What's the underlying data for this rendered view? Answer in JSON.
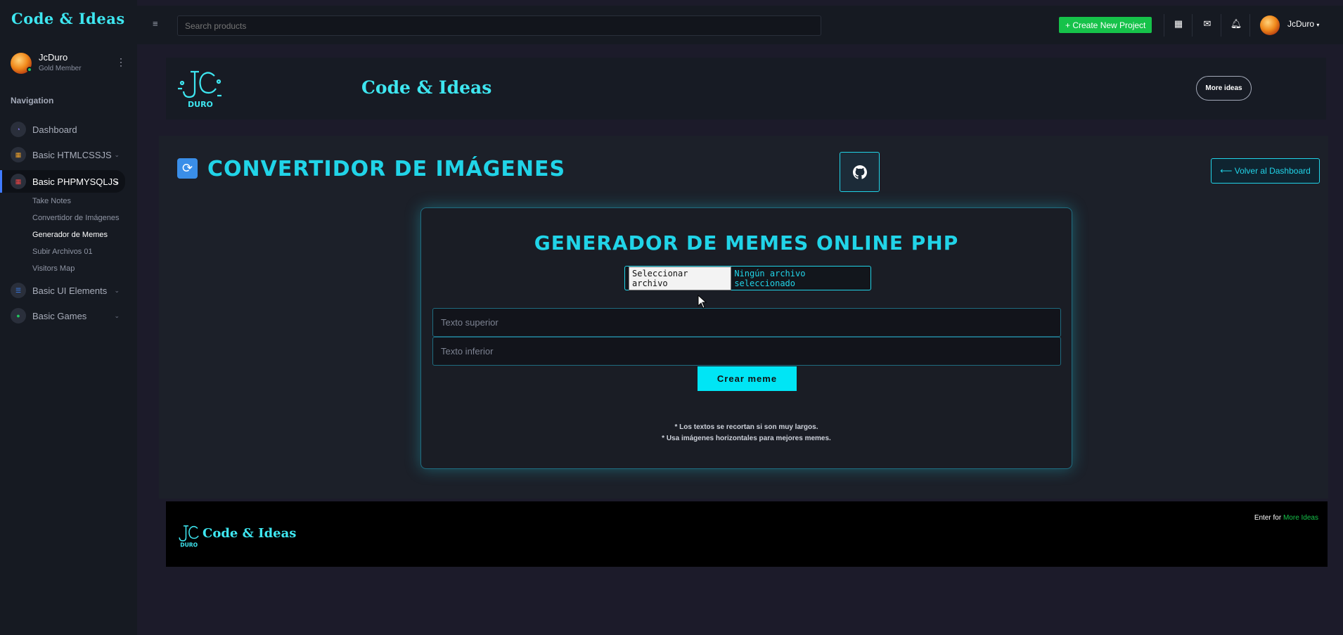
{
  "app": {
    "brand": "Code & Ideas",
    "accent_color": "#21d4e8",
    "success_color": "#16c24a"
  },
  "sidebar": {
    "user": {
      "name": "JcDuro",
      "role": "Gold Member"
    },
    "nav_title": "Navigation",
    "items": [
      {
        "label": "Dashboard",
        "icon": "speedometer-icon"
      },
      {
        "label": "Basic HTMLCSSJS",
        "icon": "grid-icon"
      },
      {
        "label": "Basic PHPMYSQLJS",
        "icon": "grid-icon"
      },
      {
        "label": "Basic UI Elements",
        "icon": "layers-icon"
      },
      {
        "label": "Basic Games",
        "icon": "gamepad-icon"
      }
    ],
    "sub_items": [
      {
        "label": "Take Notes"
      },
      {
        "label": "Convertidor de Imágenes"
      },
      {
        "label": "Generador de Memes"
      },
      {
        "label": "Subir Archivos 01"
      },
      {
        "label": "Visitors Map"
      }
    ]
  },
  "topbar": {
    "search_placeholder": "Search products",
    "create_label": "+ Create New Project",
    "user_name": "JcDuro"
  },
  "banner": {
    "logo_text": "DURO",
    "title": "Code & Ideas",
    "more_label": "More ideas"
  },
  "page": {
    "title": "CONVERTIDOR DE IMÁGENES",
    "back_label": "⟵ Volver al Dashboard"
  },
  "card": {
    "title": "GENERADOR DE MEMES ONLINE PHP",
    "file_button": "Seleccionar archivo",
    "file_status": "Ningún archivo seleccionado",
    "top_placeholder": "Texto superior",
    "bottom_placeholder": "Texto inferior",
    "submit_label": "Crear meme",
    "note1": "* Los textos se recortan si son muy largos.",
    "note2": "* Usa imágenes horizontales para mejores memes."
  },
  "footer": {
    "title": "Code & Ideas",
    "prefix": "Enter for ",
    "link": "More Ideas"
  }
}
